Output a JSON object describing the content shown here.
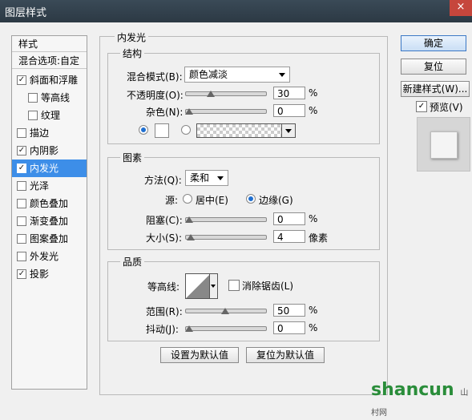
{
  "window": {
    "title": "图层样式",
    "close_glyph": "×"
  },
  "left_panel": {
    "header": "样式",
    "blend_options": "混合选项:自定",
    "items": [
      {
        "label": "斜面和浮雕",
        "checked": true
      },
      {
        "label": "等高线",
        "checked": false
      },
      {
        "label": "纹理",
        "checked": false
      },
      {
        "label": "描边",
        "checked": false
      },
      {
        "label": "内阴影",
        "checked": true
      },
      {
        "label": "内发光",
        "checked": true,
        "selected": true
      },
      {
        "label": "光泽",
        "checked": false
      },
      {
        "label": "颜色叠加",
        "checked": false
      },
      {
        "label": "渐变叠加",
        "checked": false
      },
      {
        "label": "图案叠加",
        "checked": false
      },
      {
        "label": "外发光",
        "checked": false
      },
      {
        "label": "投影",
        "checked": true
      }
    ]
  },
  "panel": {
    "title": "内发光",
    "structure": {
      "title": "结构",
      "blend_mode_label": "混合模式(B):",
      "blend_mode_value": "颜色减淡",
      "opacity_label": "不透明度(O):",
      "opacity_value": "30",
      "opacity_unit": "%",
      "opacity_level": 0.3,
      "noise_label": "杂色(N):",
      "noise_value": "0",
      "noise_unit": "%",
      "noise_level": 0
    },
    "elements": {
      "title": "图素",
      "method_label": "方法(Q):",
      "method_value": "柔和",
      "source_label": "源:",
      "source_center": "居中(E)",
      "source_edge": "边缘(G)",
      "choke_label": "阻塞(C):",
      "choke_value": "0",
      "choke_unit": "%",
      "choke_level": 0,
      "size_label": "大小(S):",
      "size_value": "4",
      "size_unit": "像素",
      "size_level": 0.02
    },
    "quality": {
      "title": "品质",
      "contour_label": "等高线:",
      "antialias_label": "消除锯齿(L)",
      "range_label": "范围(R):",
      "range_value": "50",
      "range_unit": "%",
      "range_level": 0.5,
      "jitter_label": "抖动(J):",
      "jitter_value": "0",
      "jitter_unit": "%",
      "jitter_level": 0
    },
    "make_default": "设置为默认值",
    "reset_default": "复位为默认值"
  },
  "right_panel": {
    "ok": "确定",
    "reset": "复位",
    "new_style": "新建样式(W)...",
    "preview_label": "预览(V)",
    "preview_checked": true
  },
  "watermark": {
    "text": "shancun",
    "sub": "山村网"
  },
  "check_glyph": "✓"
}
